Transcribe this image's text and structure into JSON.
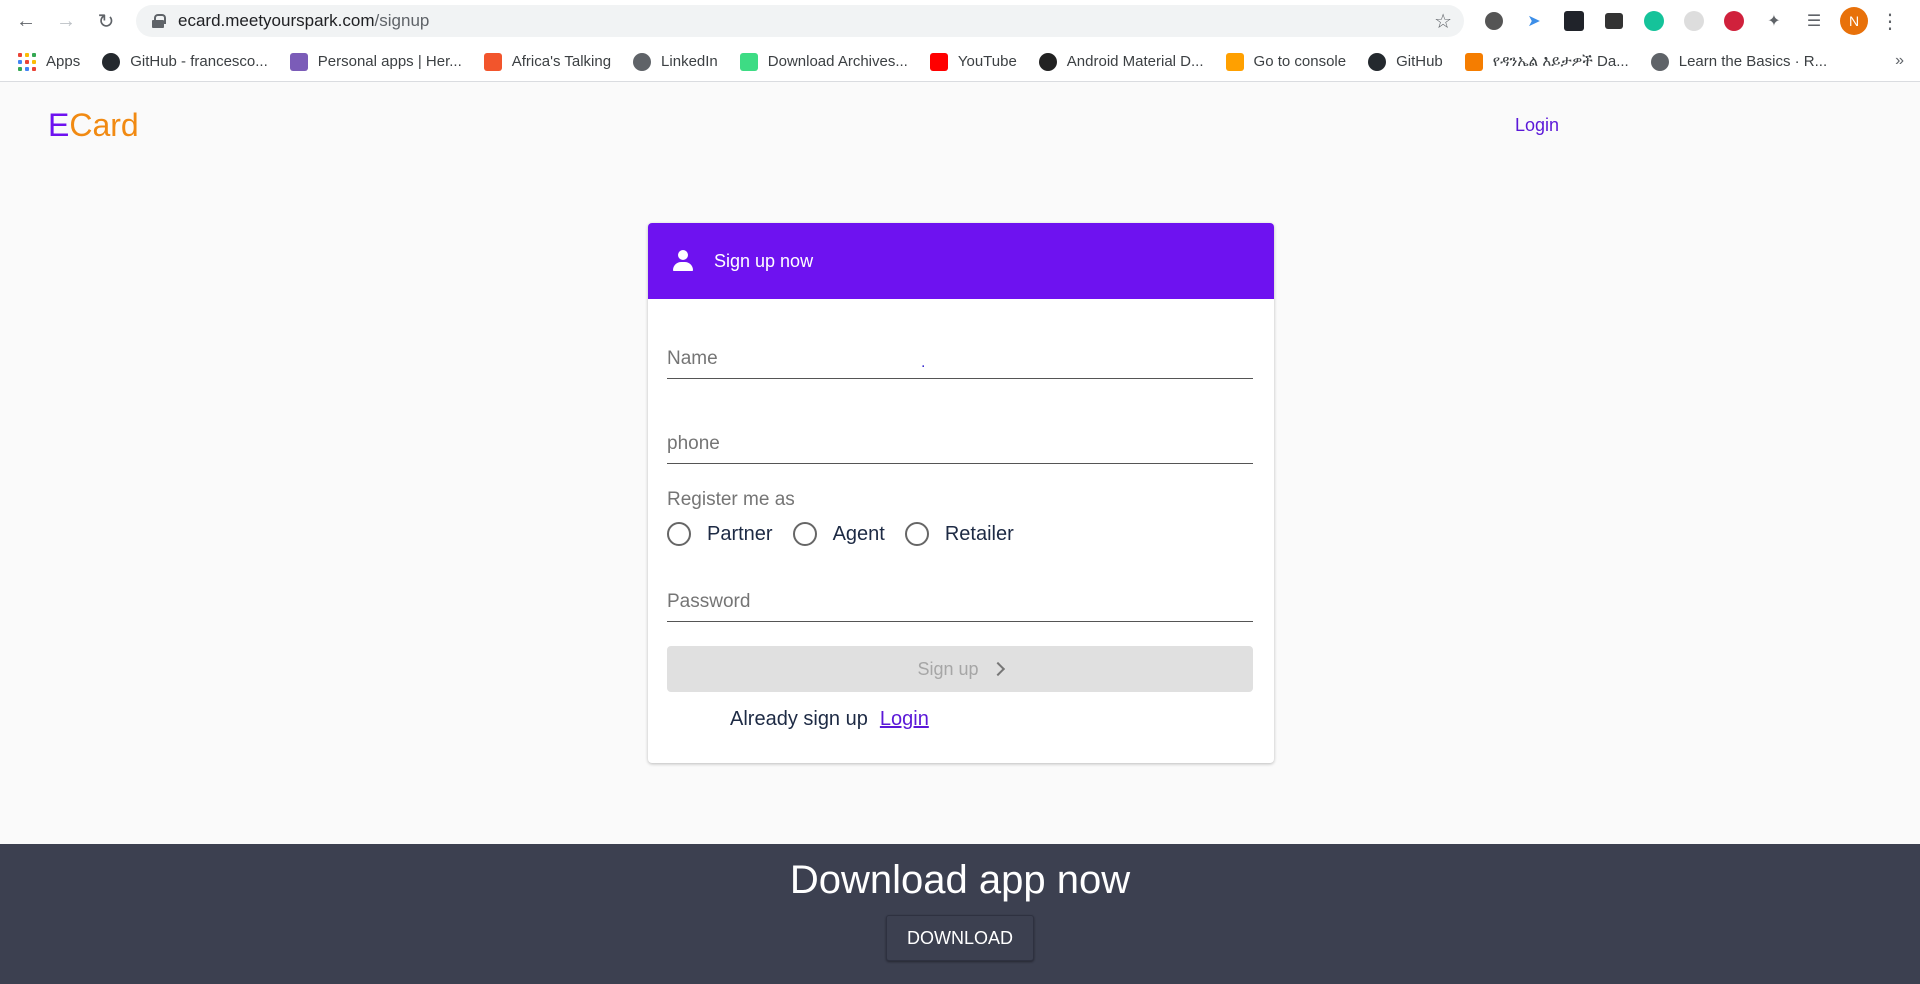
{
  "browser": {
    "url_host": "ecard.meetyourspark.com",
    "url_path": "/signup",
    "profile_initial": "N",
    "bookmarks": [
      {
        "label": "Apps",
        "icon": "apps-grid-icon"
      },
      {
        "label": "GitHub - francesco...",
        "icon": "github-icon",
        "color": "#24292e"
      },
      {
        "label": "Personal apps | Her...",
        "icon": "heroku-icon",
        "color": "#7b5cb8"
      },
      {
        "label": "Africa's Talking",
        "icon": "africas-talking-icon",
        "color": "#f2552c"
      },
      {
        "label": "LinkedIn",
        "icon": "globe-icon",
        "color": "#5f6368"
      },
      {
        "label": "Download Archives...",
        "icon": "android-icon",
        "color": "#3ddc84"
      },
      {
        "label": "YouTube",
        "icon": "youtube-icon",
        "color": "#ff0000"
      },
      {
        "label": "Android Material D...",
        "icon": "material-icon",
        "color": "#222"
      },
      {
        "label": "Go to console",
        "icon": "firebase-icon",
        "color": "#ffa000"
      },
      {
        "label": "GitHub",
        "icon": "github-icon",
        "color": "#24292e"
      },
      {
        "label": "የዳንኤል እይታዎች Da...",
        "icon": "blogger-icon",
        "color": "#f57d00"
      },
      {
        "label": "Learn the Basics · R...",
        "icon": "globe-icon",
        "color": "#5f6368"
      }
    ]
  },
  "header": {
    "logo_e": "E",
    "logo_rest": "Card",
    "login_label": "Login"
  },
  "card": {
    "title": "Sign up now",
    "name_label": "Name",
    "phone_label": "phone",
    "register_label": "Register me as",
    "roles": [
      "Partner",
      "Agent",
      "Retailer"
    ],
    "password_label": "Password",
    "signup_label": "Sign up",
    "already_text": "Already sign up",
    "login_link": "Login"
  },
  "footer": {
    "title": "Download app now",
    "download_label": "DOWNLOAD"
  },
  "colors": {
    "accent": "#6e12f0",
    "logo_secondary": "#f18a12",
    "footer_bg": "#3c4050"
  }
}
